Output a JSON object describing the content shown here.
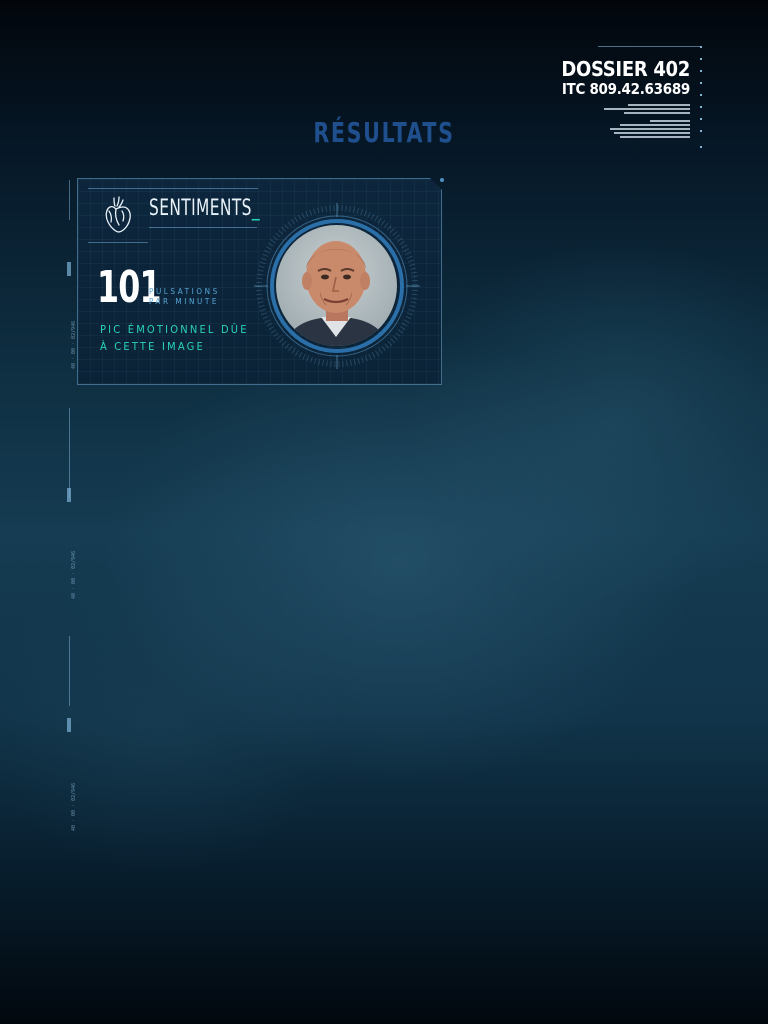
{
  "header": {
    "dossier_title": "DOSSIER 402",
    "dossier_code": "ITC 809.42.63689",
    "page_title": "RÉSULTATS"
  },
  "ruler": {
    "labels": [
      "40 · 00 · 02/946",
      "40 · 00 · 02/946",
      "40 · 00 · 02/946"
    ]
  },
  "card": {
    "section_label": "SENTIMENTS",
    "cursor": "_",
    "bpm_value": "101",
    "bpm_unit_line1": "PULSATIONS",
    "bpm_unit_line2": "PAR MINUTE",
    "emotion_line1": "PIC ÉMOTIONNEL DÛE",
    "emotion_line2": "À CETTE IMAGE",
    "icon": "anatomical-heart-icon"
  },
  "colors": {
    "accent_teal": "#2ad4b8",
    "accent_blue": "#57a7d8",
    "title_blue": "#1f4f8c",
    "line_blue": "#6eaad2"
  }
}
